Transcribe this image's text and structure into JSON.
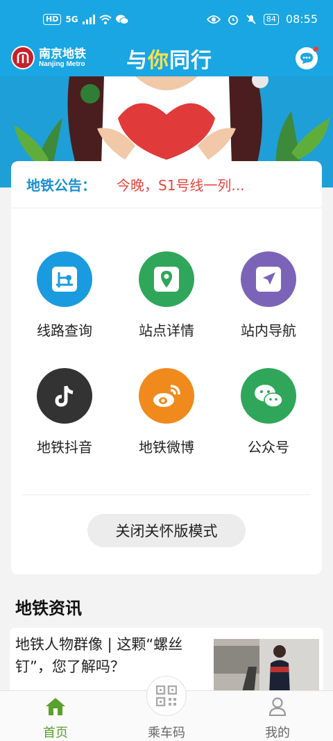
{
  "status_bar": {
    "left_badges": [
      "HD",
      "5G"
    ],
    "battery": "84",
    "time": "08:55"
  },
  "header": {
    "logo_cn": "南京地铁",
    "logo_en": "Nanjing Metro",
    "slogan_part1": "与",
    "slogan_highlight": "你",
    "slogan_part2": "同行",
    "accent_color": "#1aa6e2"
  },
  "notice": {
    "label": "地铁公告：",
    "text": "今晚，S1号线一列..."
  },
  "services": [
    {
      "label": "线路查询",
      "icon": "route-map-icon",
      "color": "#1a9be0"
    },
    {
      "label": "站点详情",
      "icon": "location-pin-icon",
      "color": "#2fa65a"
    },
    {
      "label": "站内导航",
      "icon": "navigation-arrow-icon",
      "color": "#7b64b8"
    },
    {
      "label": "地铁抖音",
      "icon": "douyin-icon",
      "color": "#333333"
    },
    {
      "label": "地铁微博",
      "icon": "weibo-icon",
      "color": "#f08a1c"
    },
    {
      "label": "公众号",
      "icon": "wechat-icon",
      "color": "#2fa65a"
    }
  ],
  "elder_mode_button": "关闭关怀版模式",
  "news": {
    "section_title": "地铁资讯",
    "items": [
      {
        "title": "地铁人物群像 | 这颗“螺丝钉”，您了解吗？"
      }
    ]
  },
  "tabbar": {
    "tabs": [
      {
        "label": "首页",
        "icon": "home-icon",
        "active": true
      },
      {
        "label": "乘车码",
        "icon": "qr-code-icon",
        "active": false
      },
      {
        "label": "我的",
        "icon": "profile-icon",
        "active": false
      }
    ]
  }
}
